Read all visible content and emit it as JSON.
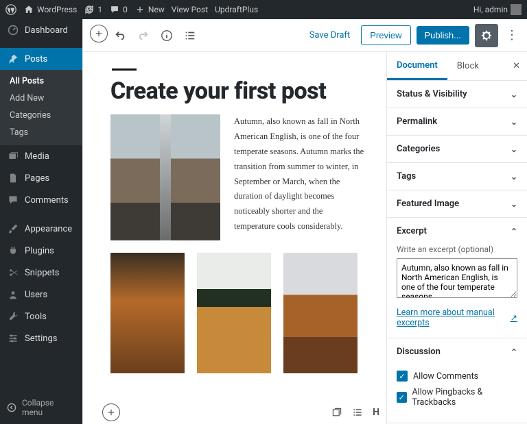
{
  "adminbar": {
    "site_name": "WordPress",
    "updates_count": "1",
    "comments_count": "0",
    "new_label": "New",
    "view_post": "View Post",
    "updraft": "UpdraftPlus",
    "greeting": "Hi, admin"
  },
  "adminmenu": {
    "dashboard": "Dashboard",
    "posts": "Posts",
    "posts_sub": {
      "all": "All Posts",
      "add": "Add New",
      "cats": "Categories",
      "tags": "Tags"
    },
    "media": "Media",
    "pages": "Pages",
    "comments": "Comments",
    "appearance": "Appearance",
    "plugins": "Plugins",
    "snippets": "Snippets",
    "users": "Users",
    "tools": "Tools",
    "settings": "Settings",
    "collapse": "Collapse menu"
  },
  "toolbar": {
    "save_draft": "Save Draft",
    "preview": "Preview",
    "publish": "Publish..."
  },
  "post": {
    "title": "Create your first post",
    "body": "Autumn, also known as fall in North American English, is one of the four temperate seasons. Autumn marks the transition from summer to winter, in September or March, when the duration of daylight becomes noticeably shorter and the temperature cools considerably."
  },
  "footer_labels": {
    "h": "H"
  },
  "settings": {
    "tabs": {
      "document": "Document",
      "block": "Block"
    },
    "panels": {
      "status": "Status & Visibility",
      "permalink": "Permalink",
      "categories": "Categories",
      "tags": "Tags",
      "featured": "Featured Image",
      "excerpt": "Excerpt",
      "excerpt_hint": "Write an excerpt (optional)",
      "excerpt_value": "Autumn, also known as fall in North American English, is one of the four temperate seasons...",
      "excerpt_link": "Learn more about manual excerpts",
      "discussion": "Discussion",
      "allow_comments": "Allow Comments",
      "allow_pingbacks": "Allow Pingbacks & Trackbacks"
    }
  }
}
